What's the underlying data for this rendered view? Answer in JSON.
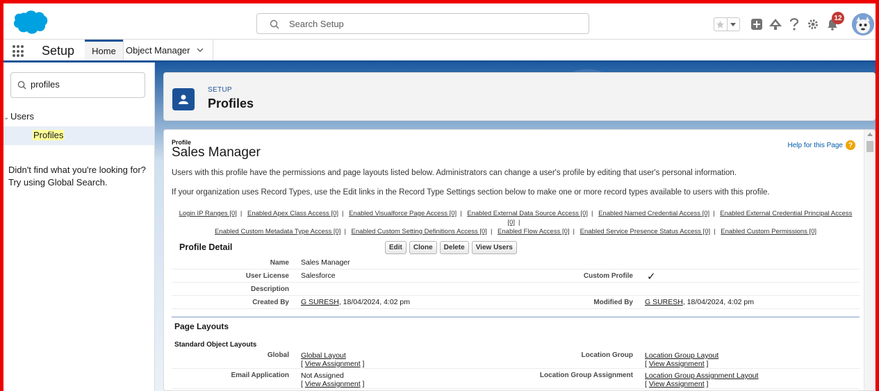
{
  "header": {
    "search_placeholder": "Search Setup",
    "notification_count": "12"
  },
  "nav": {
    "app_name": "Setup",
    "tabs": [
      {
        "label": "Home"
      },
      {
        "label": "Object Manager"
      }
    ]
  },
  "sidebar": {
    "quickfind_value": "profiles",
    "tree_parent": "Users",
    "tree_child": "Profiles",
    "help_line1": "Didn't find what you're looking for?",
    "help_line2": "Try using Global Search."
  },
  "page_header": {
    "eyebrow": "SETUP",
    "title": "Profiles"
  },
  "profile": {
    "label": "Profile",
    "name": "Sales Manager",
    "help_link": "Help for this Page",
    "desc1": "Users with this profile have the permissions and page layouts listed below. Administrators can change a user's profile by editing that user's personal information.",
    "desc2": "If your organization uses Record Types, use the Edit links in the Record Type Settings section below to make one or more record types available to users with this profile.",
    "links_row1": [
      "Login IP Ranges [0]",
      "Enabled Apex Class Access [0]",
      "Enabled Visualforce Page Access [0]",
      "Enabled External Data Source Access [0]",
      "Enabled Named Credential Access [0]",
      "Enabled External Credential Principal Access [0]"
    ],
    "links_row2": [
      "Enabled Custom Metadata Type Access [0]",
      "Enabled Custom Setting Definitions Access [0]",
      "Enabled Flow Access [0]",
      "Enabled Service Presence Status Access [0]",
      "Enabled Custom Permissions [0]"
    ],
    "detail_title": "Profile Detail",
    "buttons": {
      "edit": "Edit",
      "clone": "Clone",
      "delete": "Delete",
      "view_users": "View Users"
    },
    "fields": {
      "name_label": "Name",
      "name_value": "Sales Manager",
      "license_label": "User License",
      "license_value": "Salesforce",
      "custom_label": "Custom Profile",
      "custom_value": "✓",
      "description_label": "Description",
      "created_label": "Created By",
      "created_user": "G SURESH",
      "created_date": ", 18/04/2024, 4:02 pm",
      "modified_label": "Modified By",
      "modified_user": "G SURESH",
      "modified_date": ", 18/04/2024, 4:02 pm"
    },
    "page_layouts_title": "Page Layouts",
    "std_layouts_title": "Standard Object Layouts",
    "layouts": {
      "global_label": "Global",
      "global_value": "Global Layout",
      "location_group_label": "Location Group",
      "location_group_value": "Location Group Layout",
      "email_label": "Email Application",
      "email_value": "Not Assigned",
      "lga_label": "Location Group Assignment",
      "lga_value": "Location Group Assignment Layout",
      "view_assignment": "View Assignment",
      "bracket_open": "[ ",
      "bracket_close": " ]"
    }
  }
}
